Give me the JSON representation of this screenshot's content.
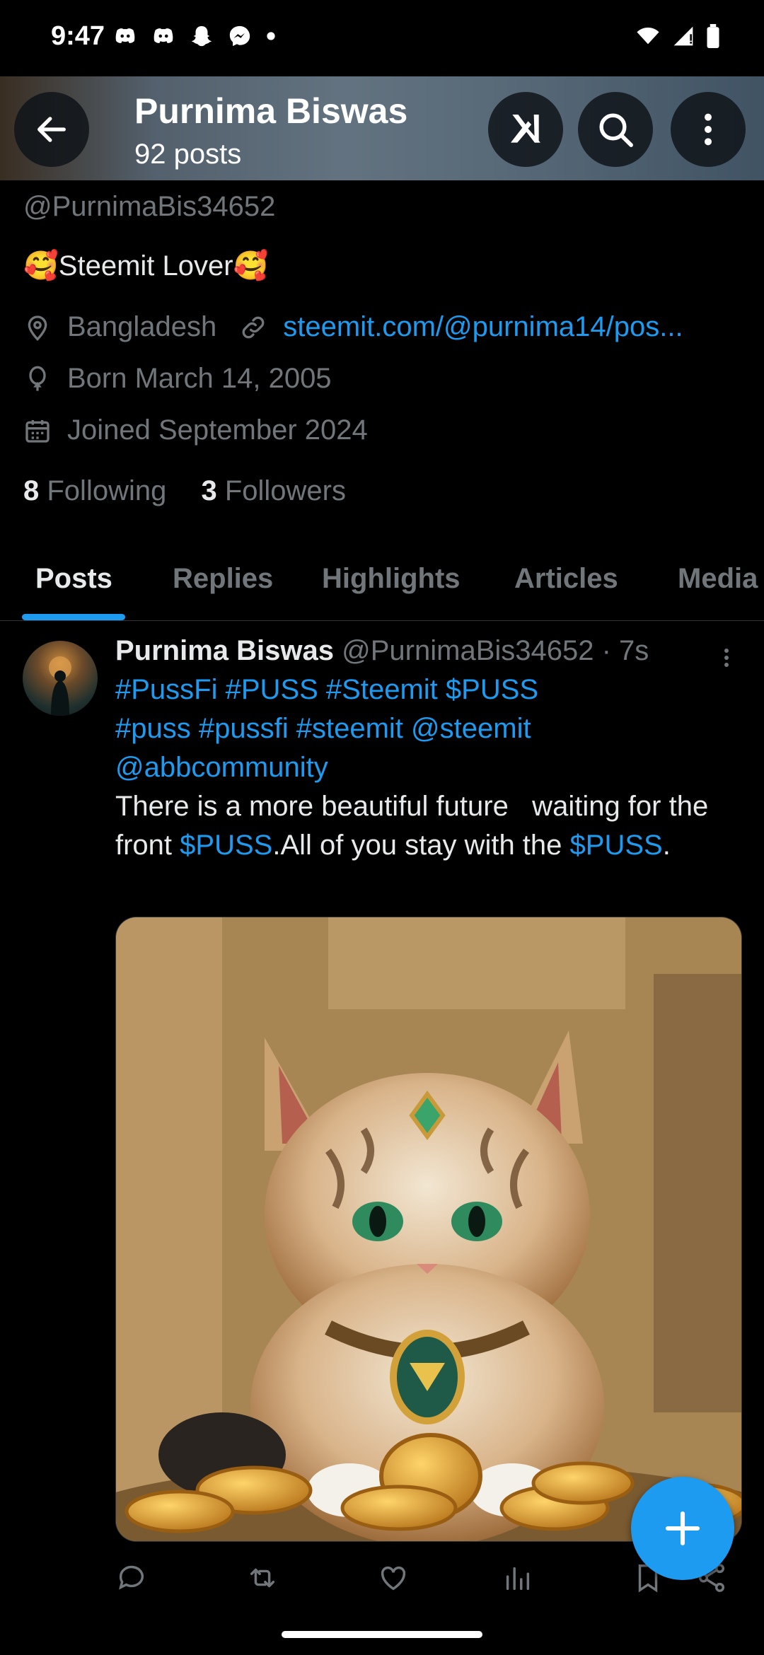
{
  "status_bar": {
    "time": "9:47",
    "left_icons": [
      "discord-icon",
      "discord-icon",
      "snapchat-icon",
      "messenger-icon",
      "dot-icon"
    ],
    "right_icons": [
      "wifi-icon",
      "signal-icon",
      "battery-icon"
    ]
  },
  "header": {
    "name": "Purnima Biswas",
    "posts_count": "92 posts"
  },
  "profile": {
    "handle": "@PurnimaBis34652",
    "bio": "🥰Steemit Lover🥰",
    "location": "Bangladesh",
    "website": "steemit.com/@purnima14/pos...",
    "born": "Born March 14, 2005",
    "joined": "Joined September 2024",
    "following_count": "8",
    "following_label": "Following",
    "followers_count": "3",
    "followers_label": "Followers"
  },
  "tabs": [
    {
      "label": "Posts",
      "active": true
    },
    {
      "label": "Replies"
    },
    {
      "label": "Highlights"
    },
    {
      "label": "Articles"
    },
    {
      "label": "Media"
    }
  ],
  "post": {
    "author_name": "Purnima Biswas",
    "author_handle": "@PurnimaBis34652",
    "time": "· 7s",
    "text_line1_tags": [
      "#PussFi",
      "#PUSS",
      "#Steemit",
      "$PUSS"
    ],
    "text_line2_tags": [
      "#puss",
      "#pussfi",
      "#steemit",
      "@steemit"
    ],
    "text_line3_tags": [
      "@abbcommunity"
    ],
    "body_part1": "There is a more beautiful future   waiting for the front ",
    "cashtag1": "$PUSS",
    "body_part2": ".All of you stay with the ",
    "cashtag2": "$PUSS",
    "body_part3": "."
  },
  "colors": {
    "accent": "#1d9bf0",
    "text_primary": "#e7e9ea",
    "text_secondary": "#71767b",
    "background": "#000000"
  }
}
